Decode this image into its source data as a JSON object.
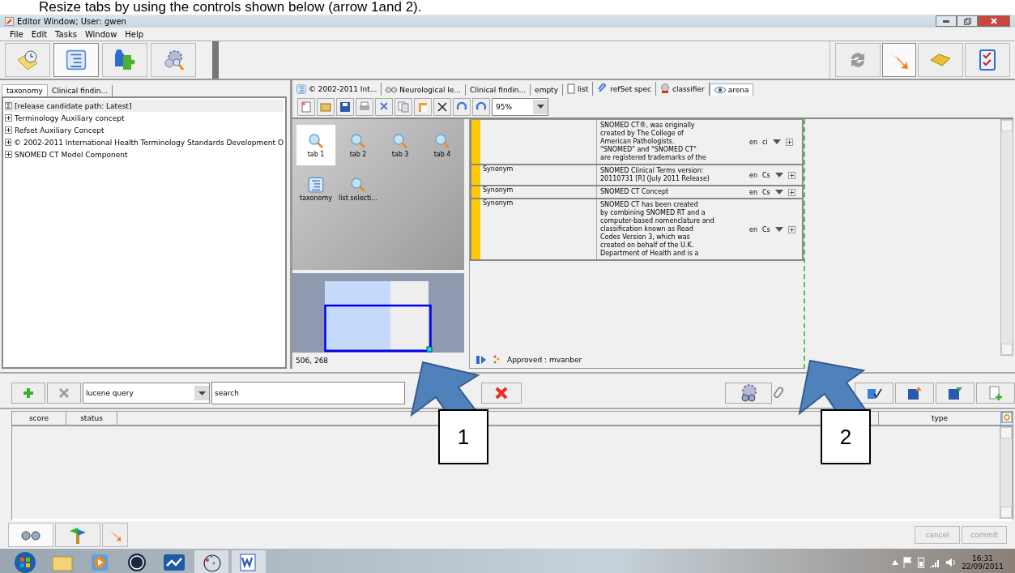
{
  "caption": "Resize tabs by using the controls shown below (arrow 1and 2).",
  "window": {
    "title": "Editor Window; User: gwen"
  },
  "menu": [
    "File",
    "Edit",
    "Tasks",
    "Window",
    "Help"
  ],
  "left_tabs": [
    {
      "label": "taxonomy",
      "selected": true
    },
    {
      "label": "Clinical findin...",
      "selected": false
    }
  ],
  "tree": {
    "root": "[release candidate path: Latest]",
    "items": [
      {
        "label": "Terminology Auxiliary concept",
        "expanded": false
      },
      {
        "label": "Refset Auxiliary Concept",
        "expanded": false
      },
      {
        "label": "© 2002-2011 International Health Terminology Standards Development O",
        "expanded": false
      },
      {
        "label": "SNOMED CT Model Component",
        "expanded": false
      }
    ]
  },
  "editor_tabs": [
    {
      "label": "© 2002-2011 Int...",
      "kind": "taxonomy",
      "selected": false
    },
    {
      "label": "Neurological le...",
      "kind": "glasses",
      "selected": false
    },
    {
      "label": "Clinical findin...",
      "kind": "plain",
      "selected": false
    },
    {
      "label": "empty",
      "kind": "plain",
      "selected": false
    },
    {
      "label": "list",
      "kind": "list",
      "selected": false
    },
    {
      "label": "refSet spec",
      "kind": "clip",
      "selected": false
    },
    {
      "label": "classifier",
      "kind": "classifier",
      "selected": false
    },
    {
      "label": "arena",
      "kind": "eye",
      "selected": true
    }
  ],
  "zoom": "95%",
  "view_tabs": [
    {
      "label": "tab 1",
      "kind": "search",
      "selected": true
    },
    {
      "label": "tab 2",
      "kind": "search",
      "selected": false
    },
    {
      "label": "tab 3",
      "kind": "search",
      "selected": false
    },
    {
      "label": "tab 4",
      "kind": "search",
      "selected": false
    },
    {
      "label": "taxonomy",
      "kind": "taxonomy",
      "selected": false
    },
    {
      "label": "list selecti...",
      "kind": "search",
      "selected": false
    }
  ],
  "coordinates": "506, 268",
  "descriptions": [
    {
      "lines": [
        "SNOMED CT®, was originally",
        "created by The College of",
        "American Pathologists.",
        "\"SNOMED\" and \"SNOMED CT\"",
        "are registered trademarks of the"
      ],
      "language": "en",
      "case": "ci"
    },
    {
      "type": "Synonym",
      "lines": [
        "SNOMED Clinical Terms version:",
        "20110731 [R] (July 2011 Release)"
      ],
      "language": "en",
      "case": "Cs"
    },
    {
      "type": "Synonym",
      "lines": [
        "SNOMED CT Concept"
      ],
      "language": "en",
      "case": "Cs"
    },
    {
      "type": "Synonym",
      "lines": [
        "SNOMED CT has been created",
        "by combining SNOMED RT and a",
        "computer-based nomenclature and",
        "classification known as Read",
        "Codes Version 3, which was",
        "created on behalf of the U.K.",
        "Department of Health and is a"
      ],
      "language": "en",
      "case": "Cs"
    }
  ],
  "status": "Approved : mvanber",
  "query": {
    "type": "lucene query",
    "value": "search"
  },
  "results": {
    "columns": [
      "score",
      "status",
      "type"
    ]
  },
  "buttons": [
    {
      "label": "cancel",
      "disabled": true
    },
    {
      "label": "commit",
      "disabled": true
    }
  ],
  "taskbar": {
    "time": "16:31",
    "date": "22/09/2011"
  },
  "callouts": [
    {
      "label": "1"
    },
    {
      "label": "2"
    }
  ]
}
